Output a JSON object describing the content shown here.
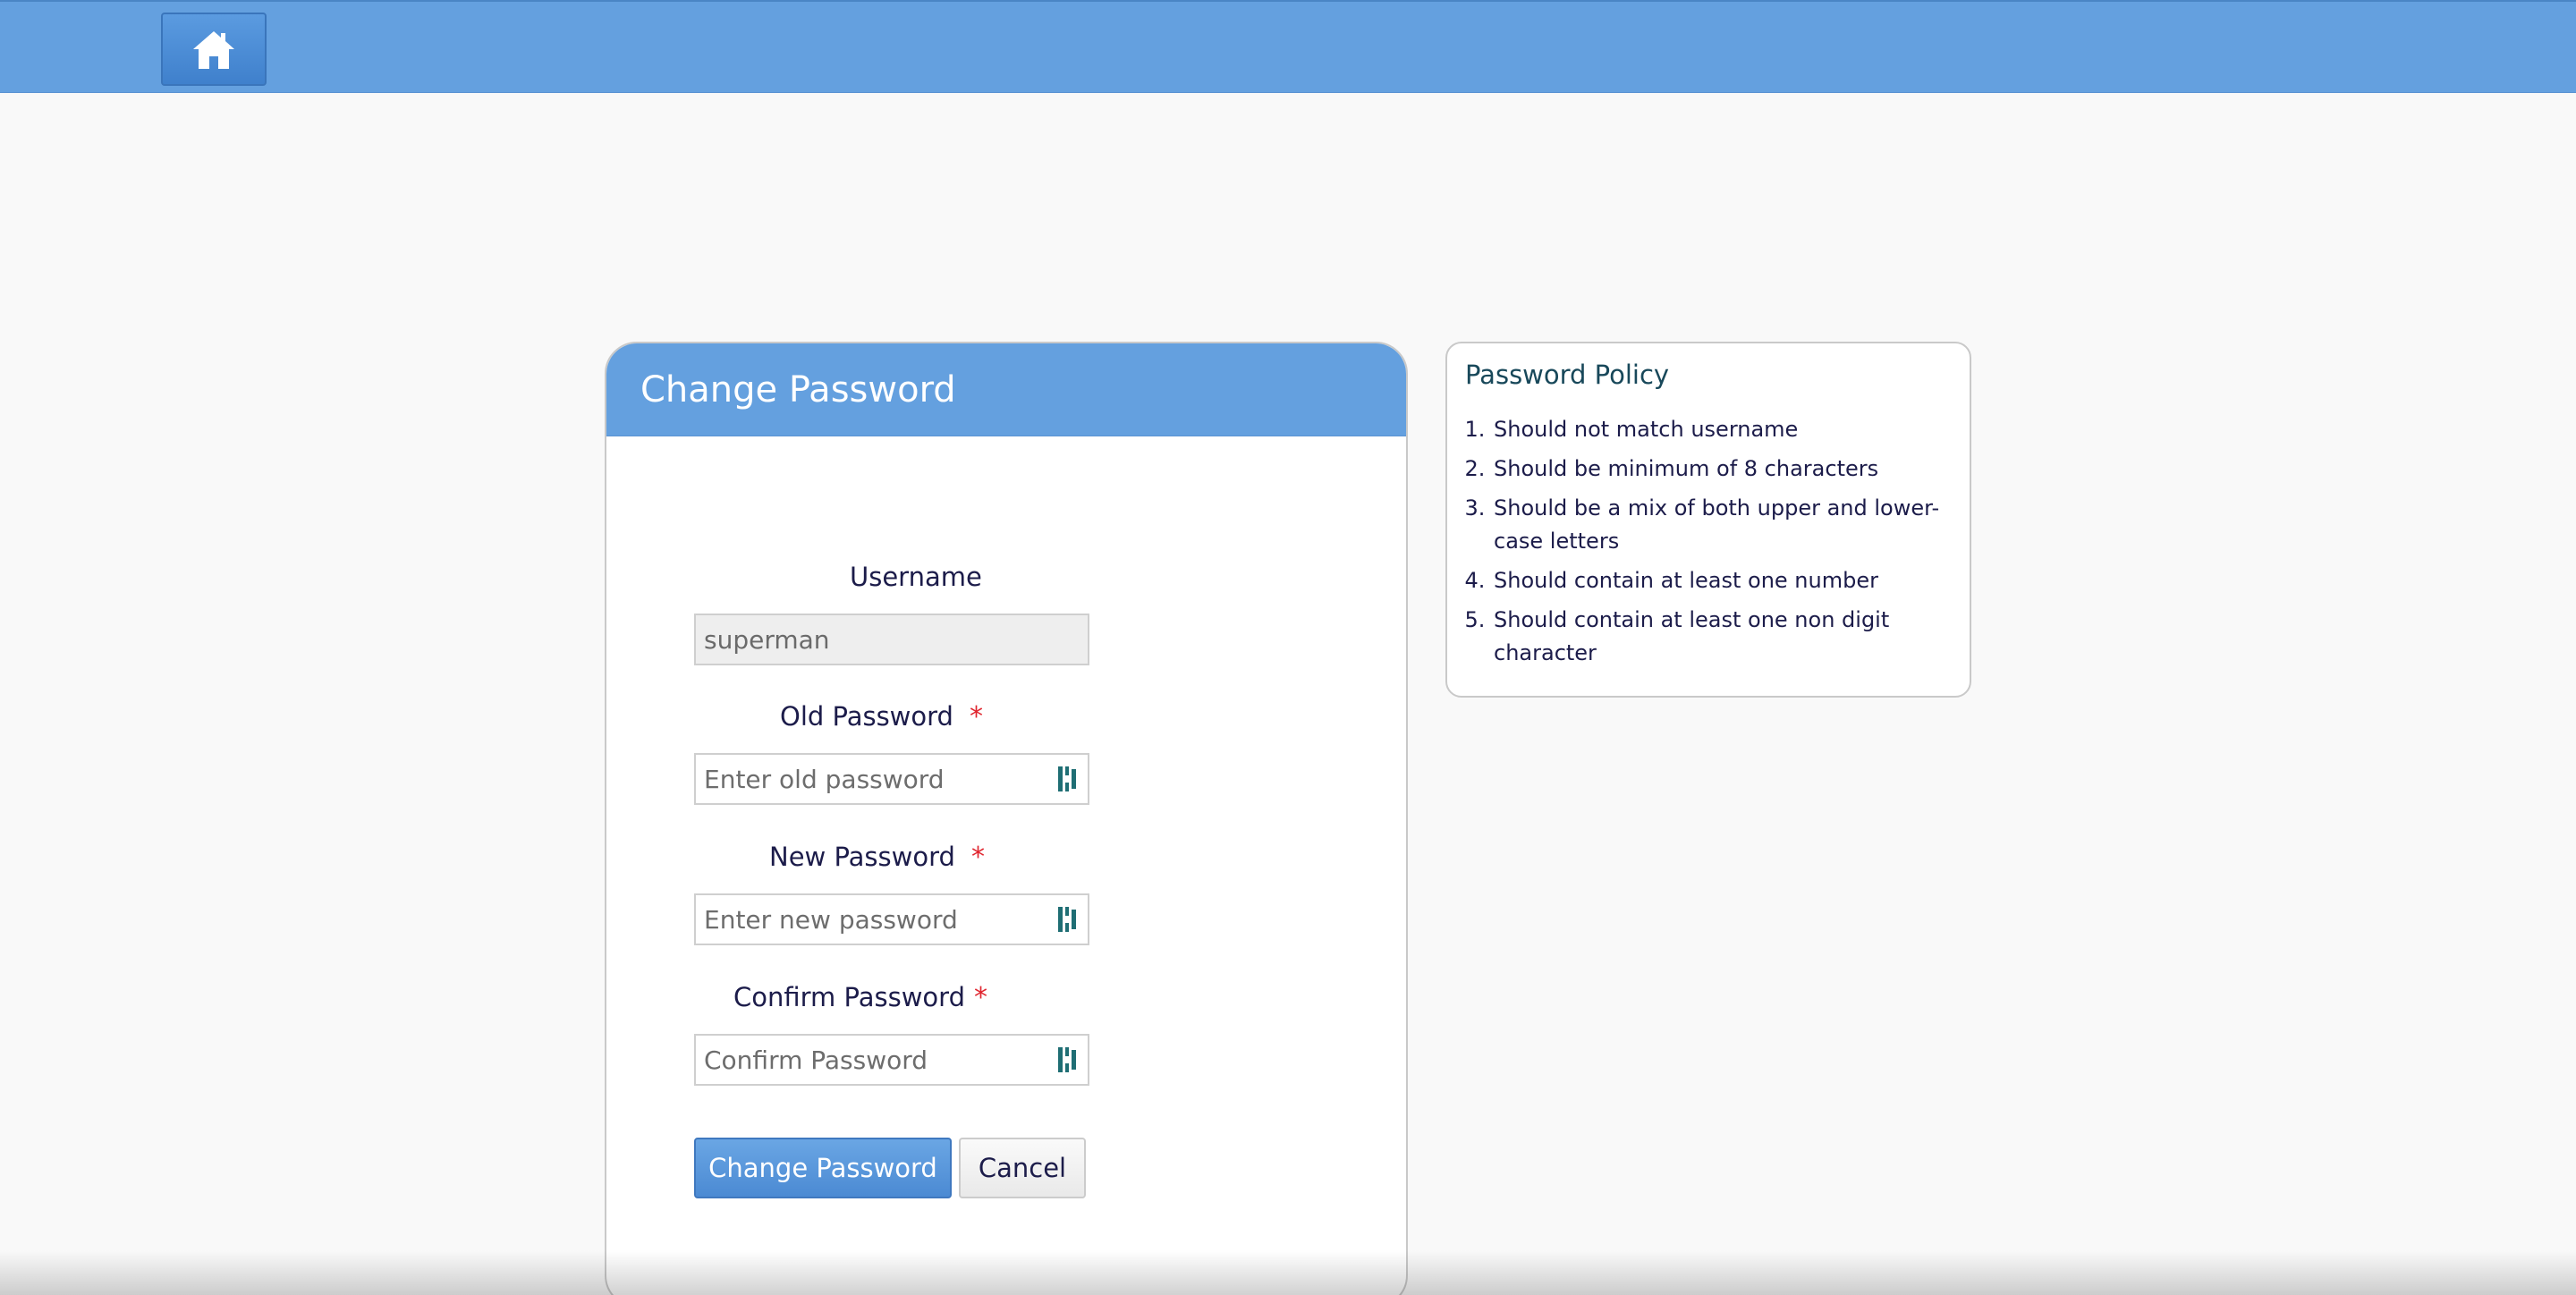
{
  "topbar": {
    "home_icon": "home-icon"
  },
  "form": {
    "title": "Change Password",
    "username_label": "Username",
    "username_value": "superman",
    "old_password_label": "Old Password",
    "old_password_placeholder": "Enter old password",
    "new_password_label": "New Password",
    "new_password_placeholder": "Enter new password",
    "confirm_password_label": "Confirm Password",
    "confirm_password_placeholder": "Confirm Password",
    "required_mark": "*",
    "submit_label": "Change Password",
    "cancel_label": "Cancel",
    "password_manager_icon": "password-manager-icon"
  },
  "policy": {
    "title": "Password Policy",
    "items": [
      "Should not match username",
      "Should be minimum of 8 characters",
      "Should be a mix of both upper and lower-case letters",
      "Should contain at least one number",
      "Should contain at least one non digit character"
    ]
  },
  "colors": {
    "header_blue": "#64a0df",
    "primary_button": "#4b8ad3",
    "required_red": "#e0262f",
    "password_icon_teal": "#1f6e74"
  }
}
